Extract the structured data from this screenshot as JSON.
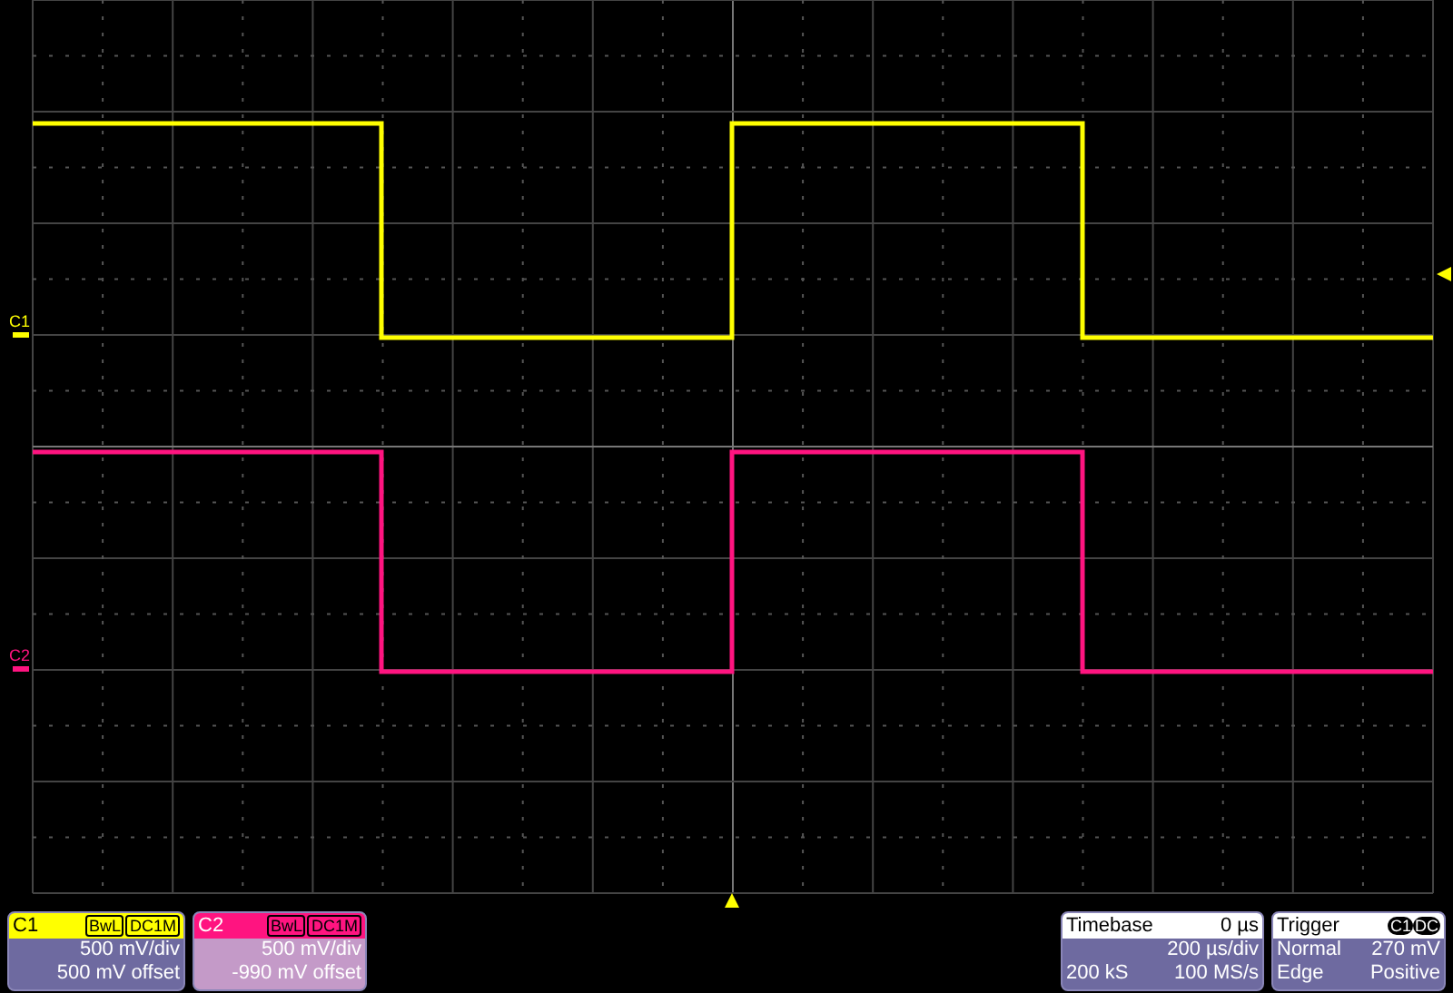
{
  "channels": [
    {
      "label": "C1",
      "trace_label": "C1",
      "color": "#ffff00",
      "badges": [
        "BwL",
        "DC1M"
      ],
      "scale": "500 mV/div",
      "offset": "500 mV offset"
    },
    {
      "label": "C2",
      "trace_label": "C2",
      "color": "#ff1480",
      "badges": [
        "BwL",
        "DC1M"
      ],
      "scale": "500 mV/div",
      "offset": "-990 mV offset"
    }
  ],
  "timebase": {
    "title": "Timebase",
    "delay": "0 µs",
    "scale": "200 µs/div",
    "samples": "200 kS",
    "rate": "100 MS/s"
  },
  "trigger": {
    "title": "Trigger",
    "source": "C1",
    "coupling": "DC",
    "mode": "Normal",
    "level": "270 mV",
    "type": "Edge",
    "slope": "Positive"
  }
}
